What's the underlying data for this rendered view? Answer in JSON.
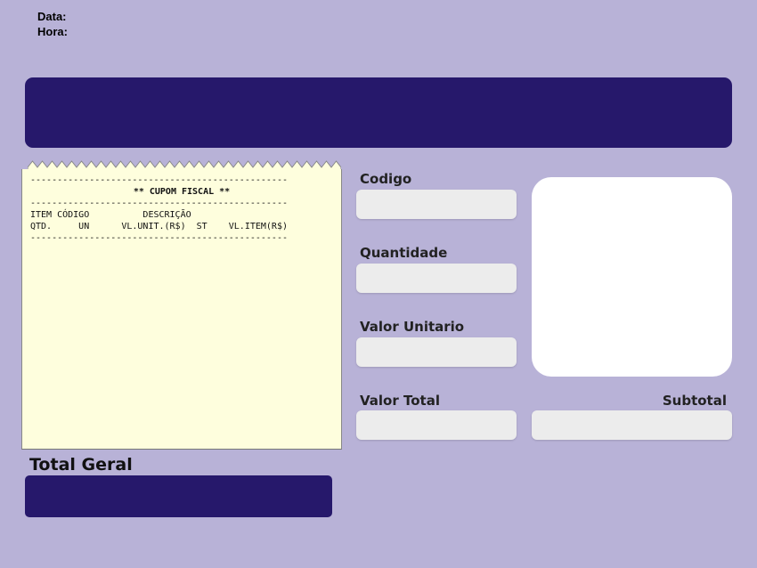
{
  "header": {
    "date_label": "Data:",
    "time_label": "Hora:"
  },
  "receipt": {
    "separator": "------------------------------------------------",
    "title": "** CUPOM FISCAL **",
    "col_row1": "ITEM CÓDIGO          DESCRIÇÃO",
    "col_row2": "QTD.     UN      VL.UNIT.(R$)  ST    VL.ITEM(R$)"
  },
  "form": {
    "codigo_label": "Codigo",
    "quantidade_label": "Quantidade",
    "valor_unitario_label": "Valor Unitario",
    "valor_total_label": "Valor Total",
    "subtotal_label": "Subtotal",
    "codigo_value": "",
    "quantidade_value": "",
    "valor_unitario_value": "",
    "valor_total_value": "",
    "subtotal_value": ""
  },
  "total": {
    "label": "Total Geral",
    "value": ""
  },
  "colors": {
    "background": "#b8b2d7",
    "banner": "#26186b",
    "receipt_paper": "#fefedd",
    "field": "#ececec"
  }
}
